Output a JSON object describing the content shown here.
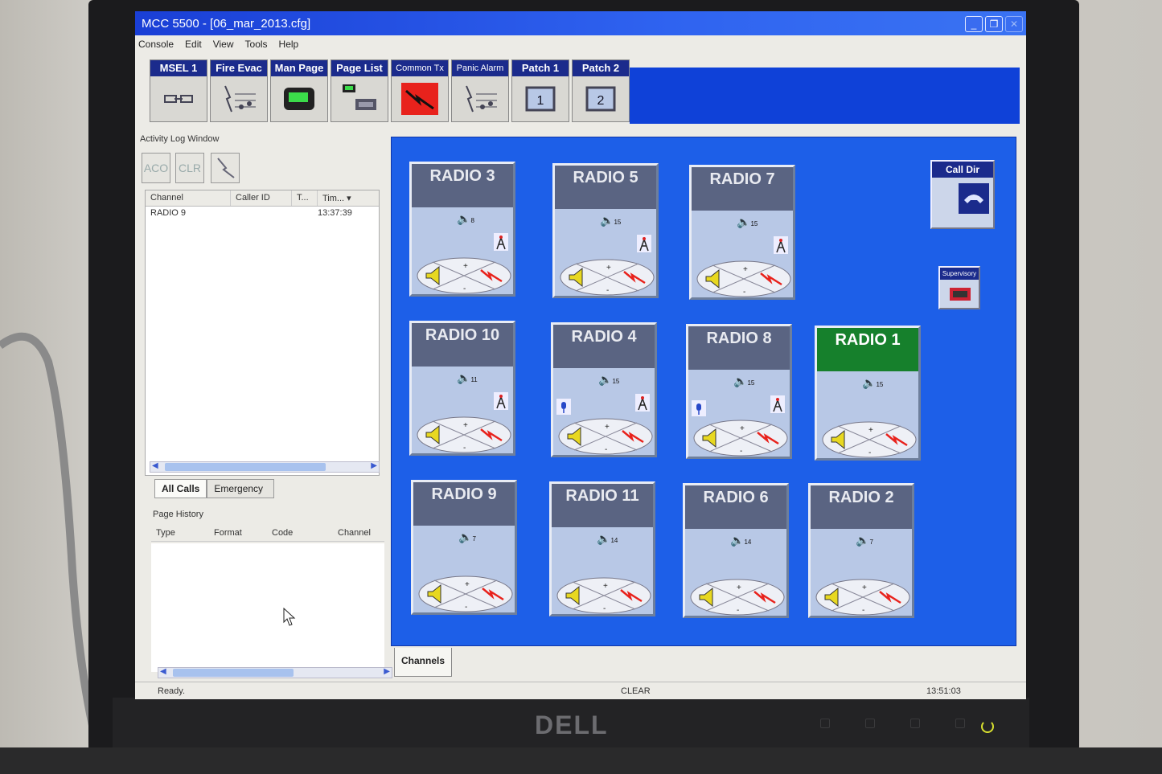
{
  "window": {
    "title": "MCC 5500 - [06_mar_2013.cfg]"
  },
  "menu": [
    "Console",
    "Edit",
    "View",
    "Tools",
    "Help"
  ],
  "toolbar": [
    {
      "label": "MSEL 1",
      "icon": "link-icon",
      "small": false
    },
    {
      "label": "Fire Evac",
      "icon": "music-lightning-icon",
      "small": false
    },
    {
      "label": "Man Page",
      "icon": "pager-icon",
      "small": false
    },
    {
      "label": "Page List",
      "icon": "page-list-icon",
      "small": false
    },
    {
      "label": "Common Tx",
      "icon": "red-lightning-icon",
      "small": true
    },
    {
      "label": "Panic Alarm",
      "icon": "music-lightning-icon",
      "small": true
    },
    {
      "label": "Patch 1",
      "icon": "patch-1-icon",
      "small": false
    },
    {
      "label": "Patch 2",
      "icon": "patch-2-icon",
      "small": false
    }
  ],
  "activity_log": {
    "title": "Activity Log Window",
    "buttons": [
      "ACO",
      "CLR"
    ],
    "columns": [
      "Channel",
      "Caller ID",
      "T...",
      "Tim..."
    ],
    "rows": [
      {
        "channel": "RADIO 9",
        "caller_id": "",
        "type": "",
        "time": "13:37:39"
      }
    ]
  },
  "call_tabs": [
    "All Calls",
    "Emergency"
  ],
  "page_history": {
    "title": "Page History",
    "columns": [
      "Type",
      "Format",
      "Code",
      "Channel"
    ]
  },
  "radios": [
    {
      "name": "RADIO 3",
      "vol": "8",
      "tower": true,
      "mic": false,
      "active": false
    },
    {
      "name": "RADIO 5",
      "vol": "15",
      "tower": true,
      "mic": false,
      "active": false
    },
    {
      "name": "RADIO 7",
      "vol": "15",
      "tower": true,
      "mic": false,
      "active": false
    },
    {
      "name": "RADIO 10",
      "vol": "11",
      "tower": true,
      "mic": false,
      "active": false
    },
    {
      "name": "RADIO 4",
      "vol": "15",
      "tower": true,
      "mic": true,
      "active": false
    },
    {
      "name": "RADIO 8",
      "vol": "15",
      "tower": true,
      "mic": true,
      "active": false
    },
    {
      "name": "RADIO 1",
      "vol": "15",
      "tower": false,
      "mic": false,
      "active": true
    },
    {
      "name": "RADIO 9",
      "vol": "7",
      "tower": false,
      "mic": false,
      "active": false
    },
    {
      "name": "RADIO 11",
      "vol": "14",
      "tower": false,
      "mic": false,
      "active": false
    },
    {
      "name": "RADIO 6",
      "vol": "14",
      "tower": false,
      "mic": false,
      "active": false
    },
    {
      "name": "RADIO 2",
      "vol": "7",
      "tower": false,
      "mic": false,
      "active": false
    }
  ],
  "side": {
    "call_dir": "Call Dir",
    "supervisory": "Supervisory"
  },
  "channels_tab": "Channels",
  "status": {
    "left": "Ready.",
    "center": "CLEAR",
    "right": "13:51:03"
  },
  "brand": "DELL",
  "colors": {
    "title_blue": "#1a3fd6",
    "panel_blue": "#1d5fe8",
    "active_green": "#16802c",
    "alert_red": "#e8221c"
  }
}
